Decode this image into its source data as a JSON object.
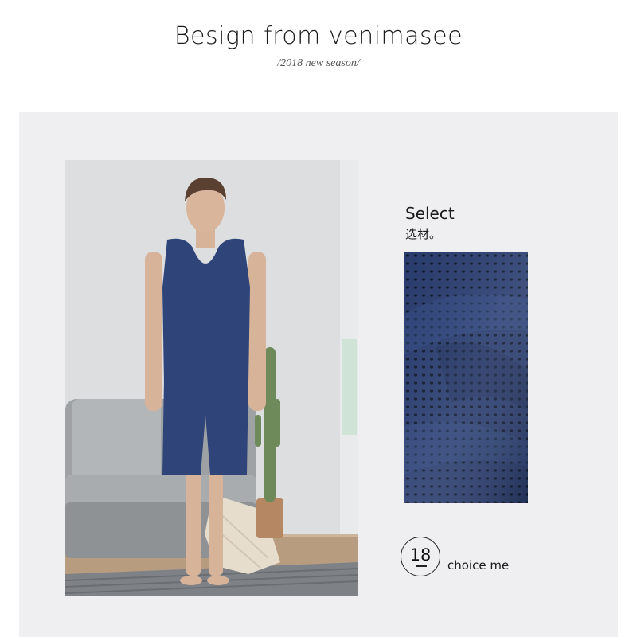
{
  "header": {
    "title": "Besign from venimasee",
    "subtitle": "/2018 new season/"
  },
  "feature": {
    "select_en": "Select",
    "select_cn": "选材。",
    "badge_number": "18",
    "choice_text": "choice me"
  },
  "colors": {
    "background": "#ffffff",
    "panel": "#efeff1",
    "garment_navy": "#2f4478",
    "fabric_navy": "#2c3f72"
  }
}
